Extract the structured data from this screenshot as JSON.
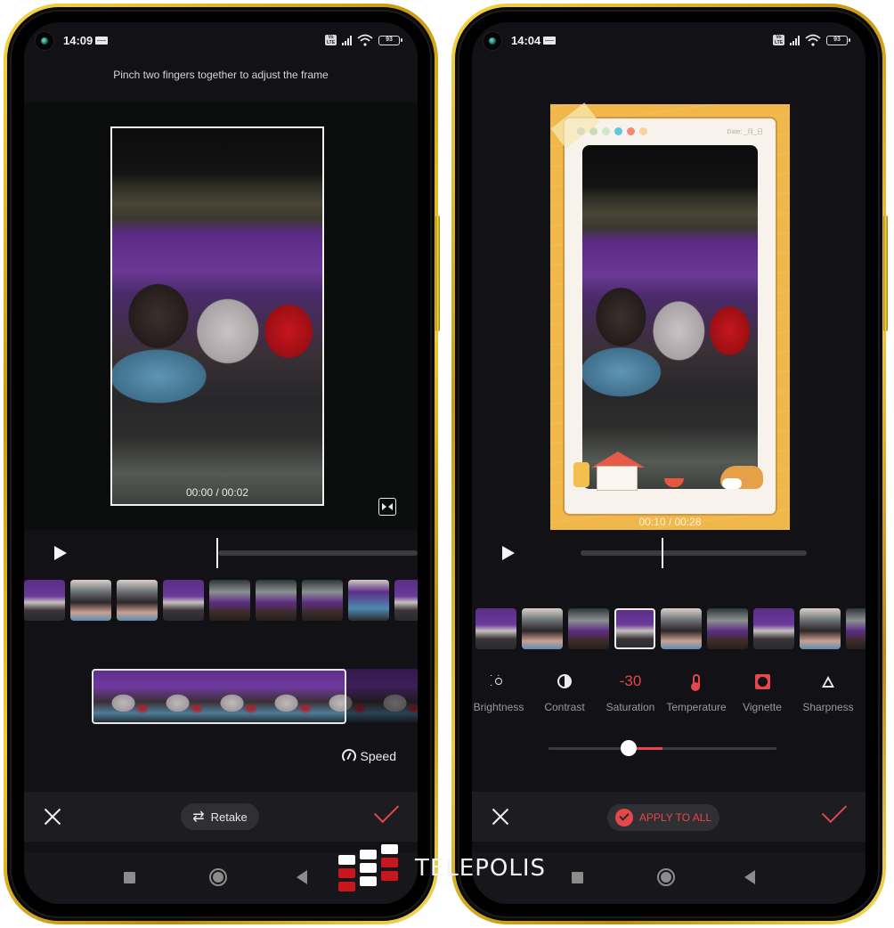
{
  "left_phone": {
    "status": {
      "time": "14:09",
      "battery": "93",
      "volte": "Vo LTE"
    },
    "hint": "Pinch two fingers together to adjust the frame",
    "timecode": "00:00 / 00:02",
    "playback_progress": 0.0,
    "thumbnails": [
      "t-purple",
      "t-white",
      "t-white",
      "t-purple",
      "t-cage",
      "t-cage",
      "t-cage",
      "t-blue",
      "t-purple"
    ],
    "clip_frames": 6,
    "speed_label": "Speed",
    "retake_label": "Retake",
    "icons": {
      "retake": "⇄"
    }
  },
  "right_phone": {
    "status": {
      "time": "14:04",
      "battery": "93",
      "volte": "Vo LTE"
    },
    "frame": {
      "date_text": "Date: _月_日",
      "dot_colors": [
        "#8fb4d9",
        "#c9dcb6",
        "#cfe6c8",
        "#5fc9d8",
        "#ef8b76",
        "#f8d39b"
      ]
    },
    "timecode": "00:10 / 00:28",
    "playback_progress": 0.36,
    "thumbnails": [
      "t-purple",
      "t-white",
      "t-cage",
      "t-purple",
      "t-white",
      "t-cage",
      "t-purple",
      "t-white",
      "t-cage"
    ],
    "selected_thumbnail": 3,
    "tools": [
      {
        "id": "brightness",
        "label": "Brightness",
        "icon": "sun-icon",
        "active": false
      },
      {
        "id": "contrast",
        "label": "Contrast",
        "icon": "contrast-icon",
        "active": false
      },
      {
        "id": "saturation",
        "label": "Saturation",
        "value": "-30",
        "active": true
      },
      {
        "id": "temperature",
        "label": "Temperature",
        "icon": "thermometer-icon",
        "active": true
      },
      {
        "id": "vignette",
        "label": "Vignette",
        "icon": "vignette-icon",
        "active": true
      },
      {
        "id": "sharpness",
        "label": "Sharpness",
        "icon": "triangle-icon",
        "active": false
      }
    ],
    "slider": {
      "value": -30,
      "min": -100,
      "max": 100
    },
    "apply_all_label": "APPLY TO ALL"
  },
  "watermark": {
    "text": "TELEPOLIS"
  },
  "colors": {
    "accent": "#e5474b",
    "frame_gold": "#f0b84a",
    "screen_bg": "#121116"
  }
}
